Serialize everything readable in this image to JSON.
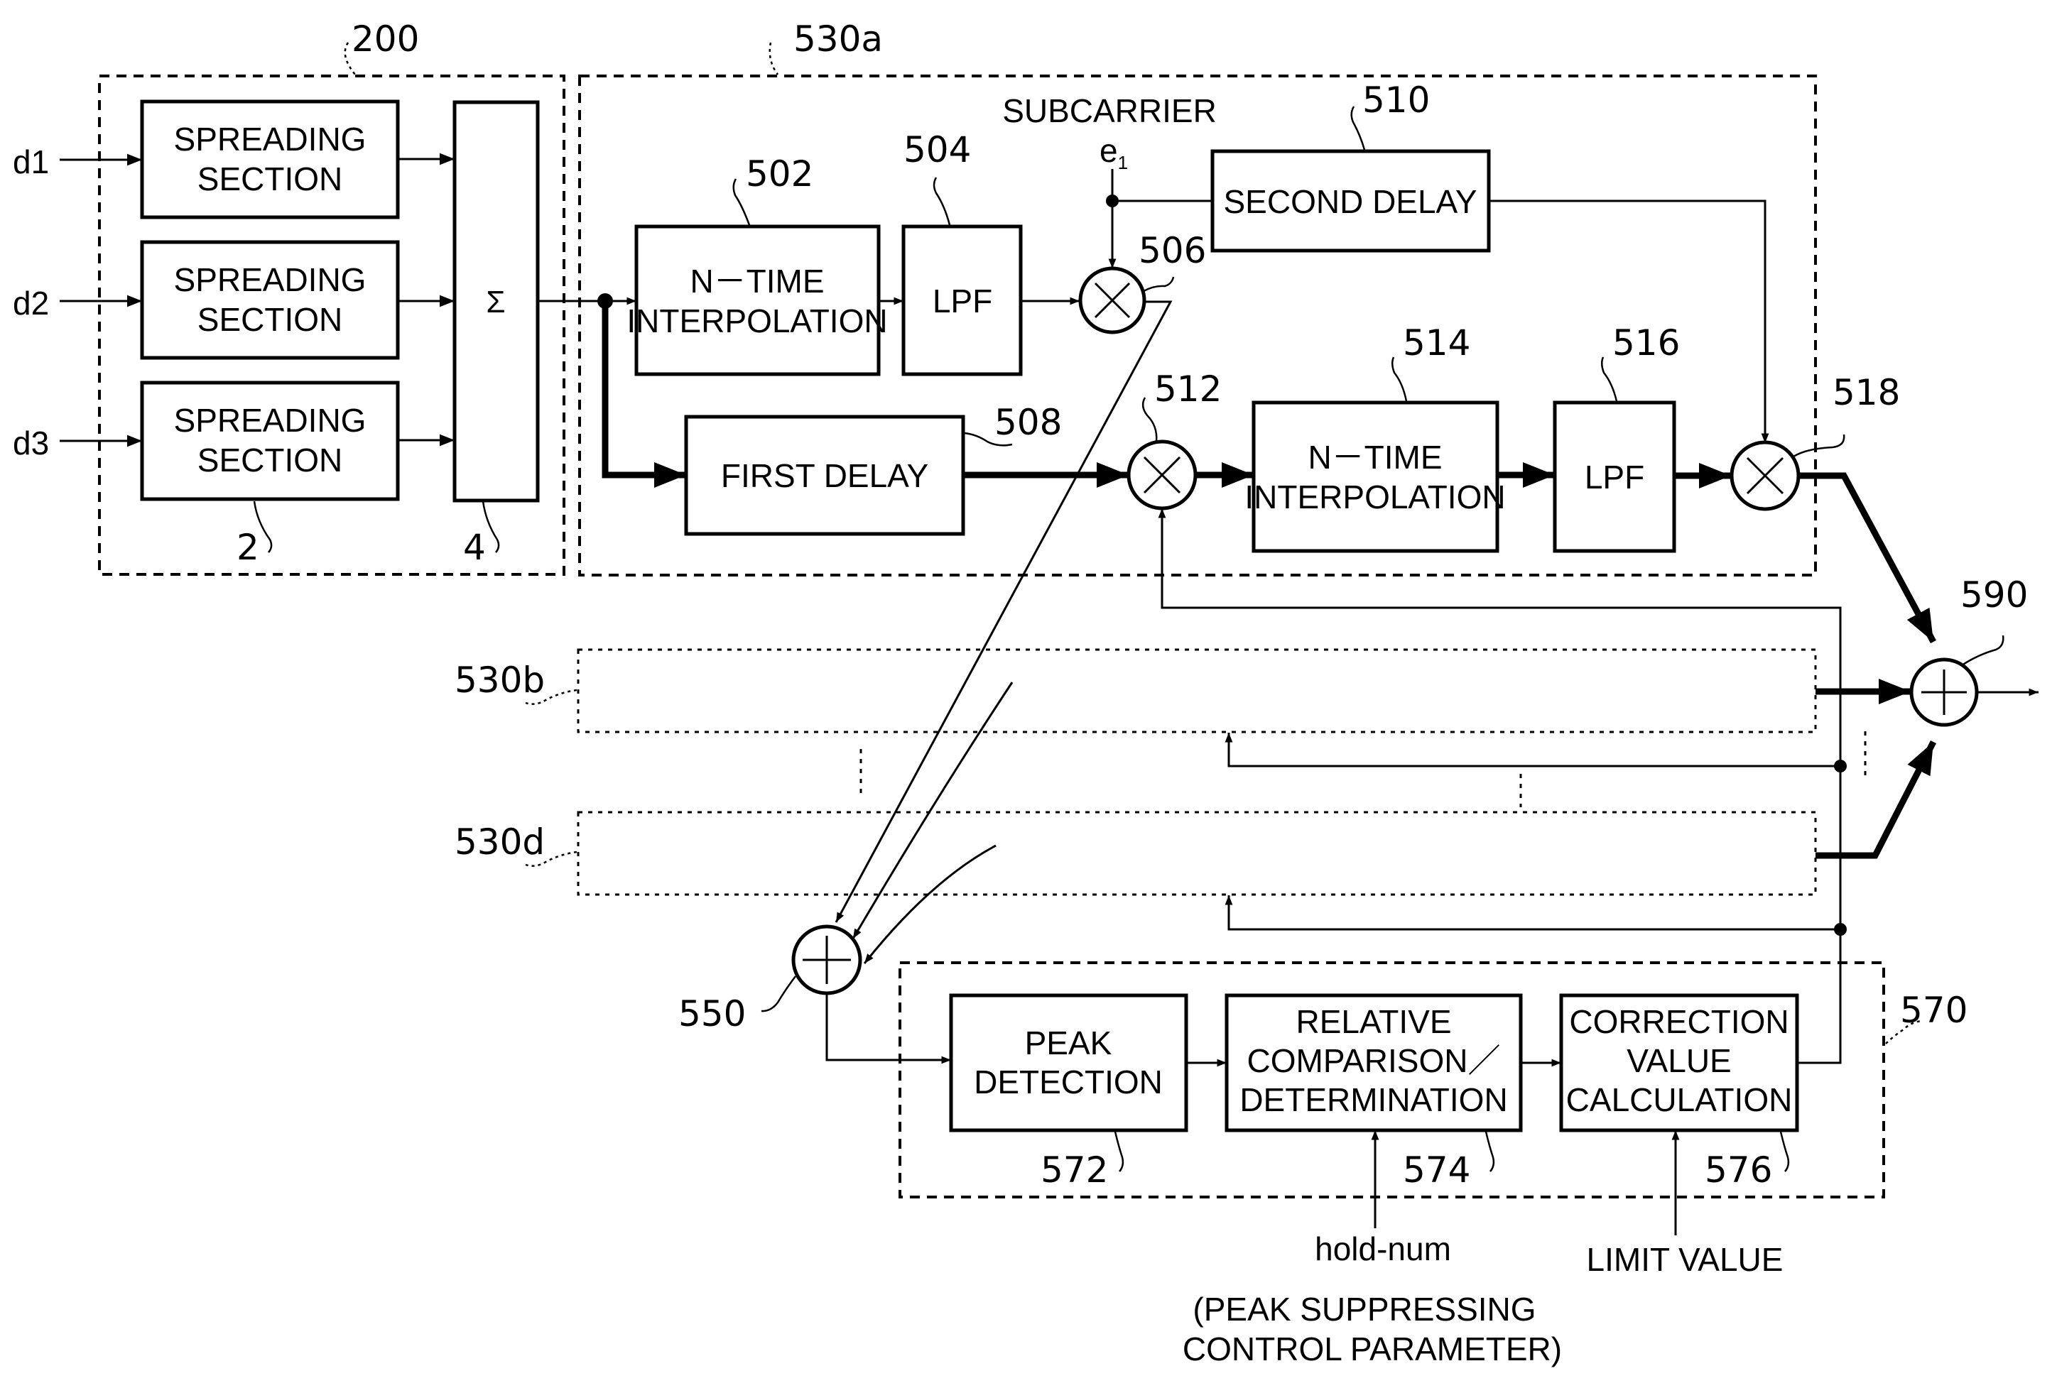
{
  "figure": {
    "inputs": [
      "d1",
      "d2",
      "d3"
    ],
    "spreader_group": {
      "ref": "200",
      "spreading_sections": [
        {
          "label_line1": "SPREADING",
          "label_line2": "SECTION"
        },
        {
          "label_line1": "SPREADING",
          "label_line2": "SECTION"
        },
        {
          "label_line1": "SPREADING",
          "label_line2": "SECTION"
        }
      ],
      "spreading_ref": "2",
      "summer_symbol": "Σ",
      "summer_ref": "4"
    },
    "branch_a": {
      "ref": "530a",
      "subcarrier_label": "SUBCARRIER",
      "subcarrier_symbol": "e",
      "subcarrier_subscript": "1",
      "interp1": {
        "line1": "N－TIME",
        "line2": "INTERPOLATION",
        "ref": "502"
      },
      "lpf1": {
        "label": "LPF",
        "ref": "504"
      },
      "mult1_ref": "506",
      "second_delay": {
        "label": "SECOND  DELAY",
        "ref": "510"
      },
      "first_delay": {
        "label": "FIRST  DELAY",
        "ref": "508"
      },
      "mult2_ref": "512",
      "interp2": {
        "line1": "N－TIME",
        "line2": "INTERPOLATION",
        "ref": "514"
      },
      "lpf2": {
        "label": "LPF",
        "ref": "516"
      },
      "mult3_ref": "518"
    },
    "branch_b_ref": "530b",
    "branch_d_ref": "530d",
    "output_adder_ref": "590",
    "feedback_adder_ref": "550",
    "peak_suppressor": {
      "ref": "570",
      "peak_detection": {
        "line1": "PEAK",
        "line2": "DETECTION",
        "ref": "572"
      },
      "relative_comparison": {
        "line1": "RELATIVE",
        "line2": "COMPARISON／",
        "line3": "DETERMINATION",
        "ref": "574"
      },
      "correction_value": {
        "line1": "CORRECTION",
        "line2": "VALUE",
        "line3": "CALCULATION",
        "ref": "576"
      },
      "hold_num_label": "hold-num",
      "limit_value_label": "LIMIT  VALUE",
      "param_note_line1": "(PEAK  SUPPRESSING",
      "param_note_line2": "CONTROL  PARAMETER)"
    }
  }
}
